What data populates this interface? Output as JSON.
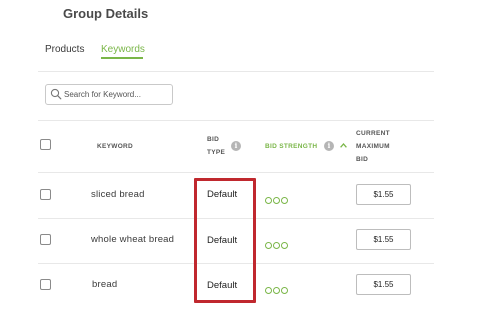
{
  "header": {
    "title": "Group Details"
  },
  "tabs": [
    {
      "label": "Products",
      "active": false
    },
    {
      "label": "Keywords",
      "active": true
    }
  ],
  "search": {
    "placeholder": "Search for Keyword..."
  },
  "table": {
    "columns": {
      "keyword": "KEYWORD",
      "bid_type_line1": "BID",
      "bid_type_line2": "TYPE",
      "bid_strength": "BID STRENGTH",
      "max_bid_line1": "CURRENT",
      "max_bid_line2": "MAXIMUM",
      "max_bid_line3": "BID"
    },
    "rows": [
      {
        "keyword": "sliced bread",
        "bid_type": "Default",
        "bid": "$1.55"
      },
      {
        "keyword": "whole wheat bread",
        "bid_type": "Default",
        "bid": "$1.55"
      },
      {
        "keyword": "bread",
        "bid_type": "Default",
        "bid": "$1.55"
      }
    ]
  },
  "colors": {
    "accent_green": "#7ab648",
    "highlight_red": "#c0282e"
  },
  "icons": {
    "search": "search-icon",
    "info": "info-icon",
    "sort": "chevron-up-icon",
    "strength": "circle-outline-icon"
  }
}
